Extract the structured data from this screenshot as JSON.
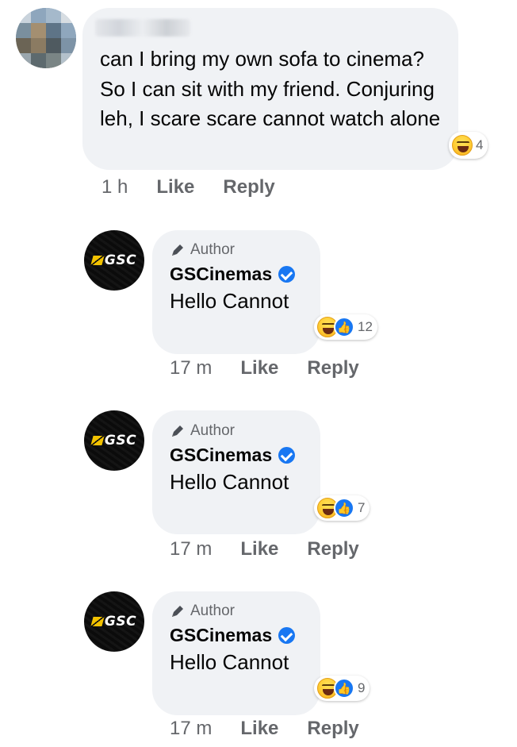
{
  "top_comment": {
    "text": "can I bring my own sofa to cinema? So I can sit with my friend. Conjuring leh, I scare scare cannot watch alone",
    "reaction_count": "4",
    "time": "1 h",
    "like_label": "Like",
    "reply_label": "Reply"
  },
  "replies": [
    {
      "badge": "Author",
      "name": "GSCinemas",
      "text": "Hello Cannot",
      "reaction_count": "12",
      "time": "17 m",
      "like_label": "Like",
      "reply_label": "Reply"
    },
    {
      "badge": "Author",
      "name": "GSCinemas",
      "text": "Hello Cannot",
      "reaction_count": "7",
      "time": "17 m",
      "like_label": "Like",
      "reply_label": "Reply"
    },
    {
      "badge": "Author",
      "name": "GSCinemas",
      "text": "Hello Cannot",
      "reaction_count": "9",
      "time": "17 m",
      "like_label": "Like",
      "reply_label": "Reply"
    }
  ],
  "logo_text": "GSC",
  "colors": {
    "bubble": "#f0f2f5",
    "secondary_text": "#65676b",
    "like_blue": "#1877f2",
    "gsc_yellow": "#f2c200"
  },
  "icons": {
    "haha": "haha-reaction-icon",
    "like": "like-reaction-icon",
    "author": "pencil-icon",
    "verified": "verified-badge-icon"
  }
}
